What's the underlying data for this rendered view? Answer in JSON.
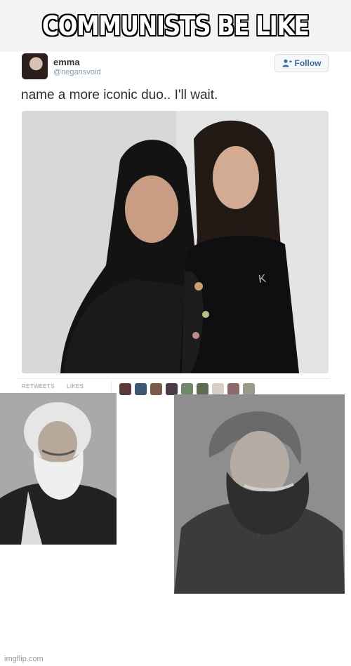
{
  "meme": {
    "top_caption": "COMMUNISTS BE LIKE",
    "watermark": "imgflip.com"
  },
  "tweet": {
    "display_name": "emma",
    "handle": "@negansvoid",
    "follow_label": "Follow",
    "text": "name a more iconic duo.. I'll wait.",
    "stats": {
      "retweets_label": "RETWEETS",
      "likes_label": "LIKES"
    },
    "liker_colors": [
      "#5a3a3a",
      "#3f5670",
      "#7a5a48",
      "#4a3a4a",
      "#6f8a6a",
      "#5d6b4f",
      "#d8d0c8",
      "#8a6a6a",
      "#9a9a8a"
    ]
  },
  "icons": {
    "follow": "add-user-icon"
  },
  "colors": {
    "header_bg": "#f4f4f4",
    "caption_fill": "#ffffff",
    "caption_outline": "#000000",
    "follow_text": "#3d6d9a"
  }
}
